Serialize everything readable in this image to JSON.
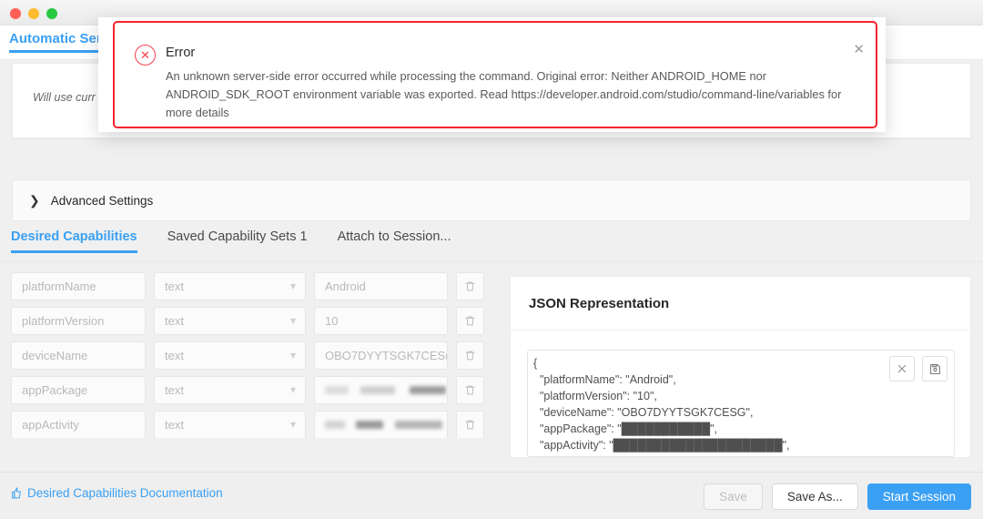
{
  "window": {
    "traffic_lights": [
      "close",
      "minimize",
      "maximize"
    ]
  },
  "top_tab": {
    "label": "Automatic Serv"
  },
  "server_card": {
    "note": "Will use curr"
  },
  "advanced": {
    "label": "Advanced Settings",
    "chevron": "chevron-right-icon"
  },
  "capability_tabs": [
    {
      "label": "Desired Capabilities",
      "active": true
    },
    {
      "label": "Saved Capability Sets 1",
      "active": false
    },
    {
      "label": "Attach to Session...",
      "active": false
    }
  ],
  "capabilities": {
    "rows": [
      {
        "name": "platformName",
        "type": "text",
        "value": "Android",
        "value_blurred": false,
        "delete_icon": "trash-icon"
      },
      {
        "name": "platformVersion",
        "type": "text",
        "value": "10",
        "value_blurred": false,
        "delete_icon": "trash-icon"
      },
      {
        "name": "deviceName",
        "type": "text",
        "value": "OBO7DYYTSGK7CES(",
        "value_blurred": false,
        "delete_icon": "trash-icon"
      },
      {
        "name": "appPackage",
        "type": "text",
        "value": "",
        "value_blurred": true,
        "delete_icon": "trash-icon"
      },
      {
        "name": "appActivity",
        "type": "text",
        "value": "",
        "value_blurred": true,
        "delete_icon": "trash-icon"
      }
    ],
    "type_chevron": "chevron-down-icon"
  },
  "json_panel": {
    "title": "JSON Representation",
    "close_icon": "close-icon",
    "save_icon": "floppy-disk-icon",
    "text": "{\n  \"platformName\": \"Android\",\n  \"platformVersion\": \"10\",\n  \"deviceName\": \"OBO7DYYTSGK7CESG\",\n  \"appPackage\": \"███████████\",\n  \"appActivity\": \"█████████████████████\",\n  \"noReset\": \"True\","
  },
  "footer": {
    "doc_link": "Desired Capabilities Documentation",
    "doc_icon": "thumbs-up-icon",
    "save_label": "Save",
    "save_as_label": "Save As...",
    "start_session_label": "Start Session"
  },
  "error_dialog": {
    "icon": "error-circle-x-icon",
    "title": "Error",
    "message": "An unknown server-side error occurred while processing the command. Original error: Neither ANDROID_HOME nor ANDROID_SDK_ROOT environment variable was exported. Read https://developer.android.com/studio/command-line/variables for more details",
    "close_icon": "close-icon"
  },
  "colors": {
    "accent_blue": "#3aa0f3",
    "error_red": "#f5222d",
    "light_red": "#ff5f57",
    "light_yellow": "#febc2e",
    "light_green": "#28c840"
  }
}
